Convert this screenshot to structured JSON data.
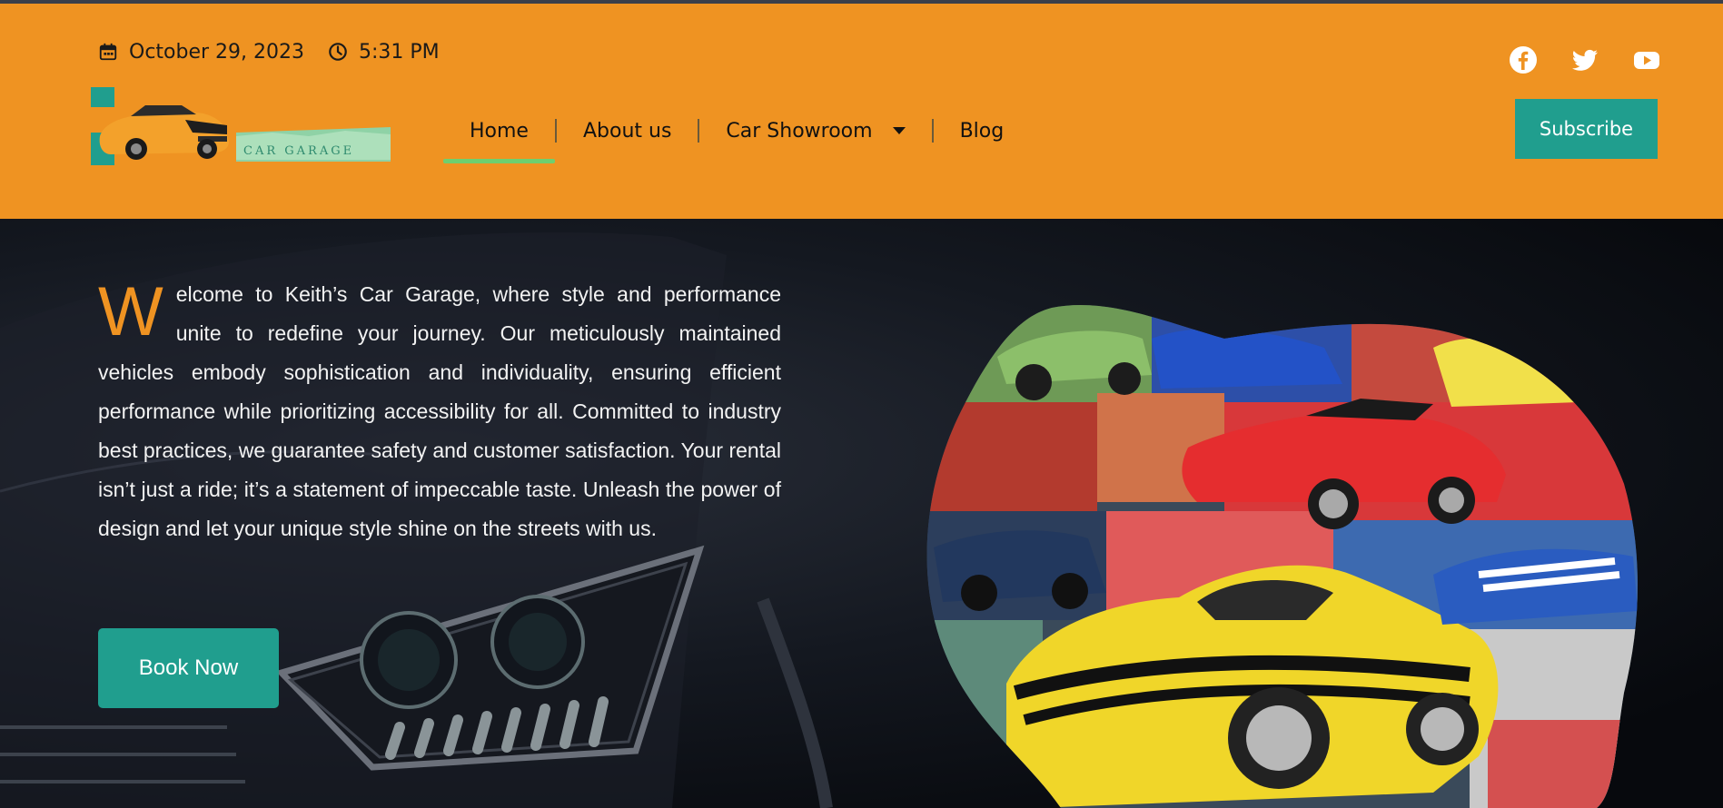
{
  "header": {
    "date": "October 29, 2023",
    "time": "5:31 PM",
    "logo_text": "CAR GARAGE",
    "nav": [
      {
        "label": "Home"
      },
      {
        "label": "About us"
      },
      {
        "label": "Car Showroom"
      },
      {
        "label": "Blog"
      }
    ],
    "subscribe_label": "Subscribe",
    "socials": [
      "facebook-icon",
      "twitter-icon",
      "youtube-icon"
    ]
  },
  "hero": {
    "dropcap": "W",
    "intro_text": "elcome to Keith’s Car Garage, where style and performance unite to redefine your journey. Our meticulously maintained vehicles embody sophistication and individuality, ensuring efficient performance while prioritizing accessibility for all. Committed to industry best practices, we guarantee safety and customer satisfaction. Your rental isn’t just a ride; it’s a statement of impeccable taste. Unleash the power of design and let your unique style shine on the streets with us.",
    "book_label": "Book Now"
  },
  "colors": {
    "header_bg": "#ef9322",
    "accent_teal": "#209e8e",
    "active_underline": "#6fcf6f",
    "hero_bg": "#0b0d12"
  }
}
